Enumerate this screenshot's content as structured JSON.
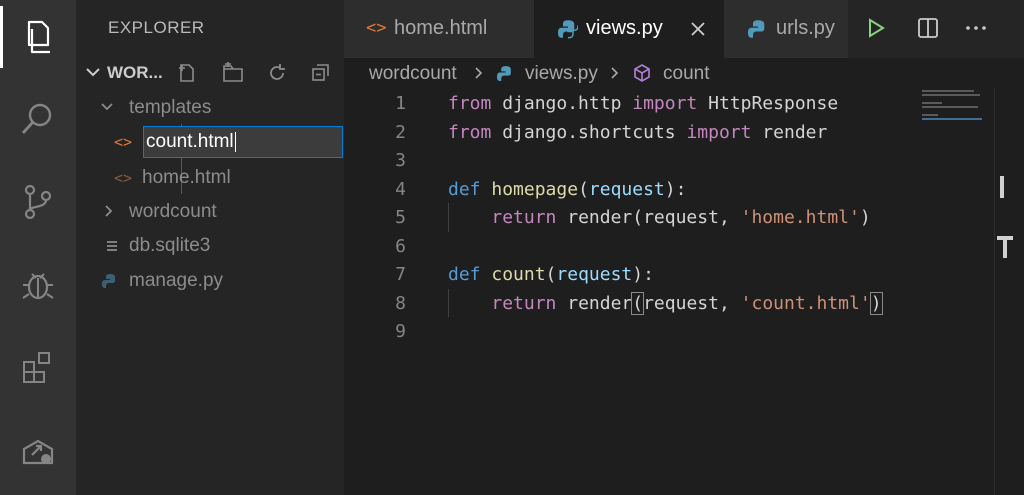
{
  "activity_bar": {
    "items": [
      {
        "name": "explorer-icon",
        "active": true
      },
      {
        "name": "search-icon"
      },
      {
        "name": "source-control-icon"
      },
      {
        "name": "debug-icon"
      },
      {
        "name": "extensions-icon"
      },
      {
        "name": "remote-explorer-icon"
      }
    ]
  },
  "sidebar": {
    "title": "EXPLORER",
    "section_name": "WOR...",
    "tree": {
      "templates": "templates",
      "rename_value": "count.html",
      "home_html": "home.html",
      "wordcount": "wordcount",
      "db": "db.sqlite3",
      "manage": "manage.py"
    },
    "icons": {
      "new_file": "new-file-icon",
      "new_folder": "new-folder-icon",
      "refresh": "refresh-icon",
      "collapse": "collapse-all-icon"
    }
  },
  "tabs": [
    {
      "label": "home.html",
      "icon": "html-file-icon",
      "active": false
    },
    {
      "label": "views.py",
      "icon": "python-file-icon",
      "active": true
    },
    {
      "label": "urls.py",
      "icon": "python-file-icon",
      "active": false
    }
  ],
  "tab_actions": [
    "run-icon",
    "split-editor-icon",
    "more-actions-icon"
  ],
  "breadcrumb": [
    "wordcount",
    "views.py",
    "count"
  ],
  "editor": {
    "lines": [
      {
        "n": "1",
        "tokens": [
          {
            "t": "from",
            "c": "kw"
          },
          {
            "t": " django.http ",
            "c": "plain"
          },
          {
            "t": "import",
            "c": "kw"
          },
          {
            "t": " HttpResponse",
            "c": "plain"
          }
        ]
      },
      {
        "n": "2",
        "tokens": [
          {
            "t": "from",
            "c": "kw"
          },
          {
            "t": " django.shortcuts ",
            "c": "plain"
          },
          {
            "t": "import",
            "c": "kw"
          },
          {
            "t": " render",
            "c": "plain"
          }
        ]
      },
      {
        "n": "3",
        "tokens": []
      },
      {
        "n": "4",
        "tokens": [
          {
            "t": "def",
            "c": "def"
          },
          {
            "t": " ",
            "c": "plain"
          },
          {
            "t": "homepage",
            "c": "fn"
          },
          {
            "t": "(",
            "c": "plain"
          },
          {
            "t": "request",
            "c": "param"
          },
          {
            "t": "):",
            "c": "plain"
          }
        ]
      },
      {
        "n": "5",
        "tokens": [
          {
            "t": "    ",
            "c": "plain"
          },
          {
            "t": "return",
            "c": "kw"
          },
          {
            "t": " render(request, ",
            "c": "plain"
          },
          {
            "t": "'home.html'",
            "c": "str"
          },
          {
            "t": ")",
            "c": "plain"
          }
        ]
      },
      {
        "n": "6",
        "tokens": []
      },
      {
        "n": "7",
        "tokens": [
          {
            "t": "def",
            "c": "def"
          },
          {
            "t": " ",
            "c": "plain"
          },
          {
            "t": "count",
            "c": "fn"
          },
          {
            "t": "(",
            "c": "plain"
          },
          {
            "t": "request",
            "c": "param"
          },
          {
            "t": "):",
            "c": "plain"
          }
        ]
      },
      {
        "n": "8",
        "tokens": [
          {
            "t": "    ",
            "c": "plain"
          },
          {
            "t": "return",
            "c": "kw"
          },
          {
            "t": " render",
            "c": "plain"
          },
          {
            "t": "(",
            "c": "plain bracket-box"
          },
          {
            "t": "request, ",
            "c": "plain"
          },
          {
            "t": "'count.html'",
            "c": "str"
          },
          {
            "t": ")",
            "c": "plain bracket-box"
          }
        ]
      },
      {
        "n": "9",
        "tokens": []
      }
    ]
  },
  "colors": {
    "accent": "#007fd4",
    "html_icon": "#e37933",
    "python_icon": "#519aba",
    "run": "#89d185"
  }
}
